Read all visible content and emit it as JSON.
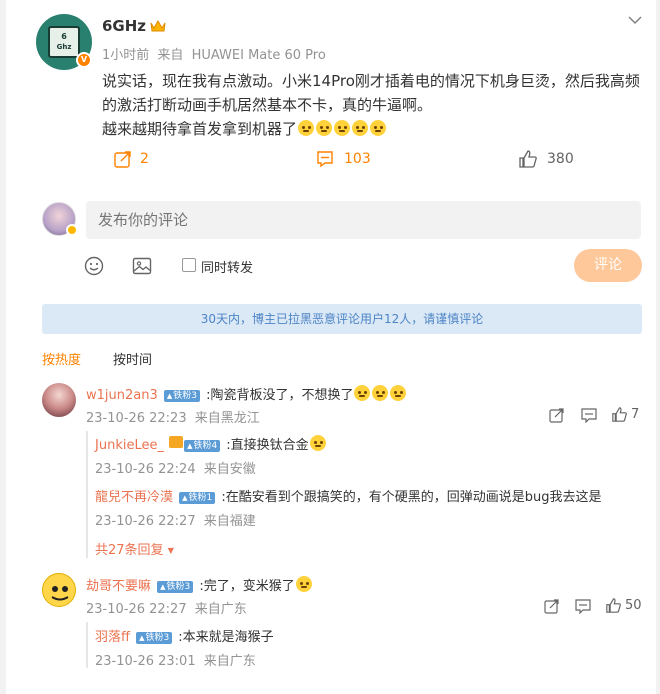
{
  "post": {
    "username": "6GHz",
    "avatar_text_top": "6",
    "avatar_text_bottom": "Ghz",
    "time": "1小时前",
    "source_prefix": "来自",
    "source": "HUAWEI Mate 60 Pro",
    "text_line1": "说实话，现在我有点激动。小米14Pro刚才插着电的情况下机身巨烫，然后我高频",
    "text_line2": "的激活打断动画手机居然基本不卡，真的牛逼啊。",
    "text_line3": "越来越期待拿首发拿到机器了",
    "emoji_count_line3": 5,
    "actions": {
      "repost_count": "2",
      "comment_count": "103",
      "like_count": "380"
    }
  },
  "compose": {
    "placeholder": "发布你的评论",
    "repost_label": "同时转发",
    "submit_label": "评论",
    "icons": [
      "emoji-icon",
      "image-icon"
    ]
  },
  "notice": "30天内，博主已拉黑恶意评论用户12人，请谨慎评论",
  "sort": {
    "hot": "按热度",
    "time": "按时间"
  },
  "comments": [
    {
      "name": "w1jun2an3",
      "level": "铁粉3",
      "text": ":陶瓷背板没了，不想换了",
      "time": "23-10-26 22:23",
      "location": "来自黑龙江",
      "likes": "7",
      "replies": [
        {
          "name": "JunkieLee_",
          "level": "铁粉4",
          "text": ":直接换钛合金",
          "time": "23-10-26 22:24",
          "location": "来自安徽"
        },
        {
          "name": "龍兒不再冷漠",
          "level": "铁粉1",
          "text": ":在酷安看到个跟搞笑的，有个硬黑的，回弹动画说是bug我去这是",
          "time": "23-10-26 22:27",
          "location": "来自福建"
        }
      ],
      "more_replies": "共27条回复"
    },
    {
      "name": "劫哥不要嘛",
      "level": "铁粉3",
      "text": ":完了，变米猴了",
      "time": "23-10-26 22:27",
      "location": "来自广东",
      "likes": "50",
      "replies": [
        {
          "name": "羽落ff",
          "level": "铁粉3",
          "text": ":本来就是海猴子",
          "time": "23-10-26 23:01",
          "location": "来自广东"
        }
      ]
    }
  ],
  "colors": {
    "accent": "#ff8200",
    "username_link": "#eb7350",
    "notice_bg": "#dbe9f7",
    "notice_text": "#4c84c5",
    "level_badge": "#5b9bd6"
  }
}
